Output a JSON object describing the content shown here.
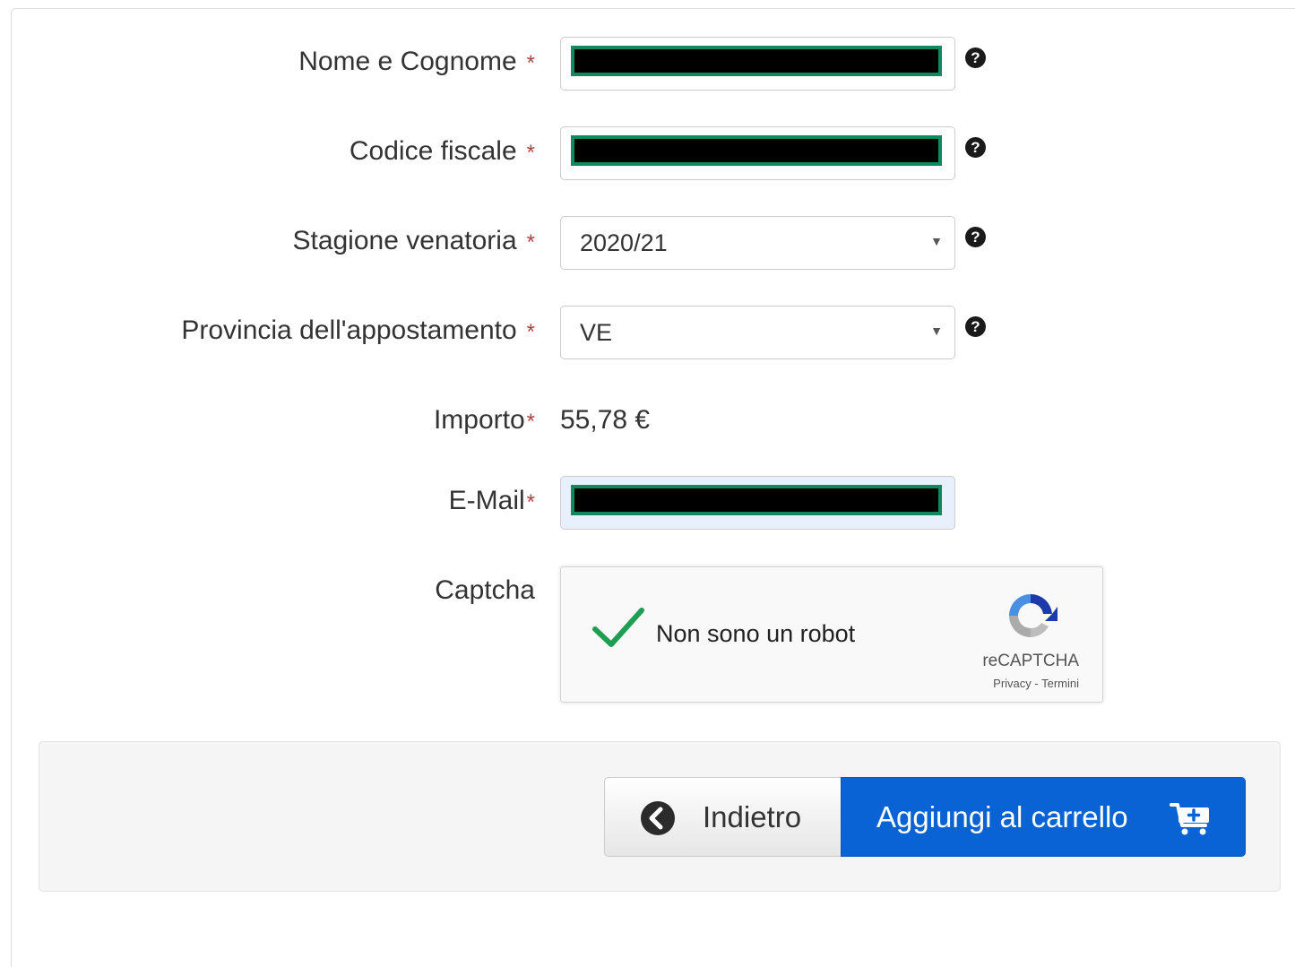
{
  "form": {
    "required_mark": "*",
    "full_name": {
      "label": "Nome e Cognome",
      "help_glyph": "?",
      "value_redacted": true
    },
    "tax_code": {
      "label": "Codice fiscale",
      "help_glyph": "?",
      "value_redacted": true
    },
    "hunting_season": {
      "label": "Stagione venatoria",
      "selected": "2020/21",
      "help_glyph": "?"
    },
    "province": {
      "label": "Provincia dell'appostamento",
      "selected": "VE",
      "help_glyph": "?"
    },
    "amount": {
      "label": "Importo",
      "value": "55,78 €"
    },
    "email": {
      "label": "E-Mail",
      "value_redacted": true
    },
    "captcha": {
      "label": "Captcha",
      "checkbox_text": "Non sono un robot",
      "checked": true,
      "brand": "reCAPTCHA",
      "links": "Privacy - Termini"
    }
  },
  "actions": {
    "back_label": "Indietro",
    "add_to_cart_label": "Aggiungi al carrello"
  },
  "icons": {
    "help": "question-circle-icon",
    "caret": "caret-down-icon",
    "back": "chevron-circle-left-icon",
    "cart": "cart-plus-icon",
    "captcha_check": "checkmark-icon",
    "captcha_logo": "recaptcha-logo-icon"
  },
  "colors": {
    "required": "#a94442",
    "primary_button": "#0a63d4",
    "check": "#1e9e52",
    "redaction_border": "#0f8a5f"
  }
}
